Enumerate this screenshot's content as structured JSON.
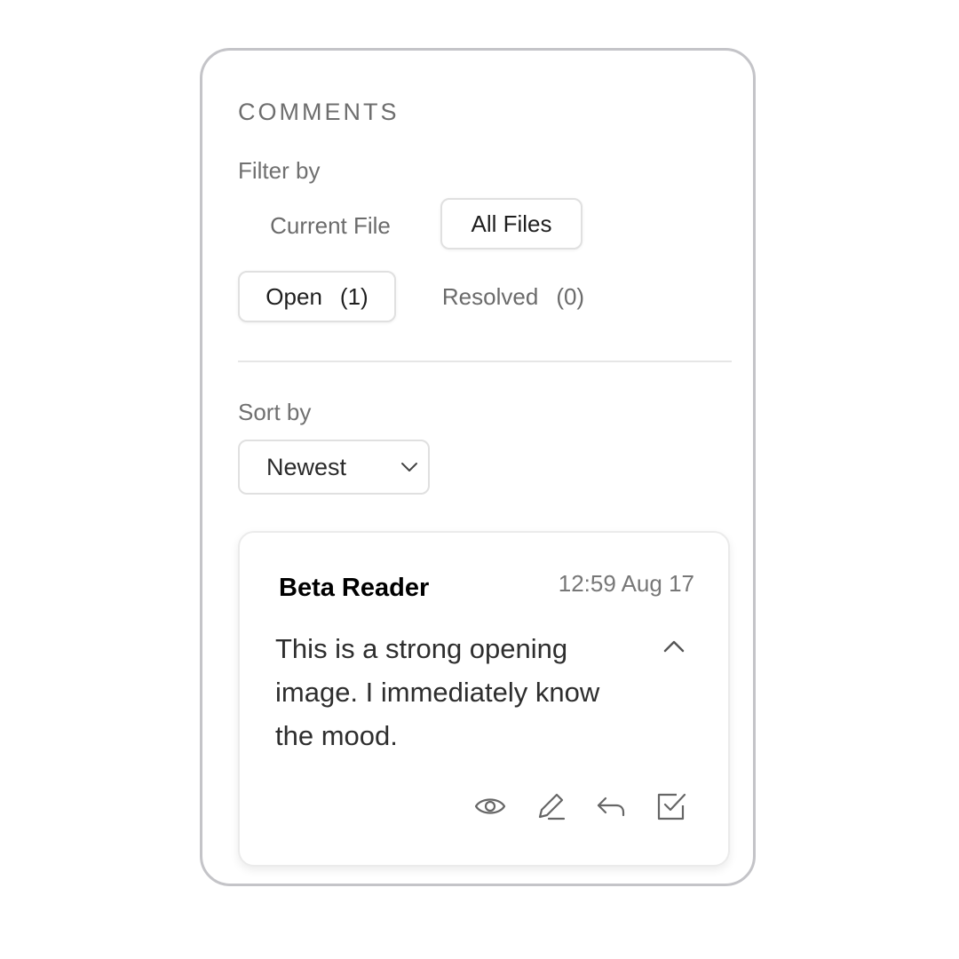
{
  "panel": {
    "title": "COMMENTS"
  },
  "filter": {
    "label": "Filter by",
    "scope_options": [
      "Current File",
      "All Files"
    ],
    "status_open_label": "Open",
    "status_open_count": "(1)",
    "status_resolved_label": "Resolved",
    "status_resolved_count": "(0)"
  },
  "sort": {
    "label": "Sort by",
    "selected": "Newest"
  },
  "comments": [
    {
      "author": "Beta Reader",
      "timestamp": "12:59 Aug 17",
      "text": "This is a strong opening image. I immediately know the mood."
    }
  ],
  "icons": {
    "collapse": "chevron-up-icon",
    "view": "eye-icon",
    "edit": "pencil-icon",
    "reply": "reply-arrow-icon",
    "resolve": "checkbox-check-icon"
  }
}
